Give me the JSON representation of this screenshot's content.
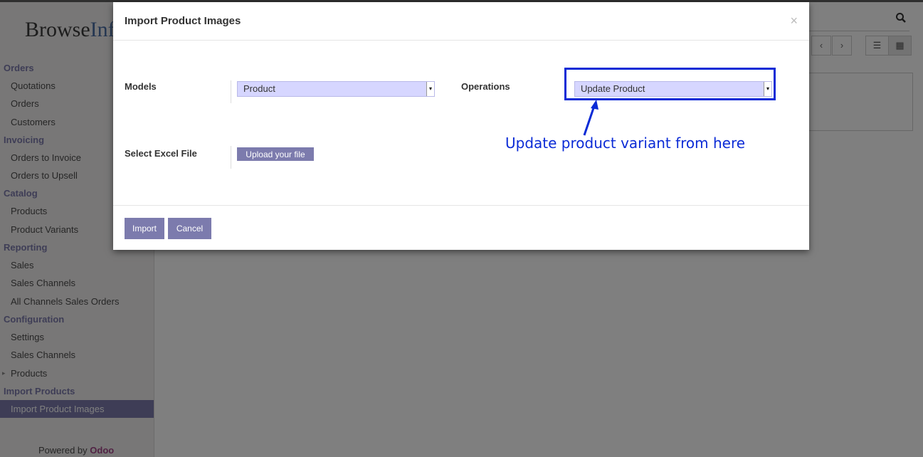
{
  "app": {
    "logo_text": "BrowseInfo",
    "logo_main": "Browse",
    "logo_accent": "Inf",
    "powered_by": "Powered by",
    "powered_brand": "Odoo"
  },
  "sidebar": {
    "sections": [
      {
        "title": "Orders",
        "items": [
          {
            "label": "Quotations"
          },
          {
            "label": "Orders"
          },
          {
            "label": "Customers"
          }
        ]
      },
      {
        "title": "Invoicing",
        "items": [
          {
            "label": "Orders to Invoice"
          },
          {
            "label": "Orders to Upsell"
          }
        ]
      },
      {
        "title": "Catalog",
        "items": [
          {
            "label": "Products"
          },
          {
            "label": "Product Variants"
          }
        ]
      },
      {
        "title": "Reporting",
        "items": [
          {
            "label": "Sales"
          },
          {
            "label": "Sales Channels"
          },
          {
            "label": "All Channels Sales Orders"
          }
        ]
      },
      {
        "title": "Configuration",
        "items": [
          {
            "label": "Settings"
          },
          {
            "label": "Sales Channels"
          },
          {
            "label": "Products",
            "has_caret": true
          }
        ]
      },
      {
        "title": "Import Products",
        "items": [
          {
            "label": "Import Product Images",
            "active": true
          }
        ]
      }
    ]
  },
  "icons": {
    "search": "search-icon",
    "prev": "chevron-left-icon",
    "next": "chevron-right-icon",
    "list_view": "list-view-icon",
    "kanban_view": "kanban-view-icon",
    "close": "close-icon",
    "caret": "caret-right-icon"
  },
  "modal": {
    "title": "Import Product Images",
    "close_symbol": "×",
    "models_label": "Models",
    "models_value": "Product",
    "operations_label": "Operations",
    "operations_value": "Update Product",
    "file_label": "Select Excel File",
    "upload_button": "Upload your file",
    "import_button": "Import",
    "cancel_button": "Cancel"
  },
  "annotation": {
    "text": "Update product variant from here",
    "color": "#0b2bd6"
  },
  "colors": {
    "accent": "#7c7bad",
    "select_bg": "#d6d6ff",
    "odoo_brand": "#a24689"
  }
}
